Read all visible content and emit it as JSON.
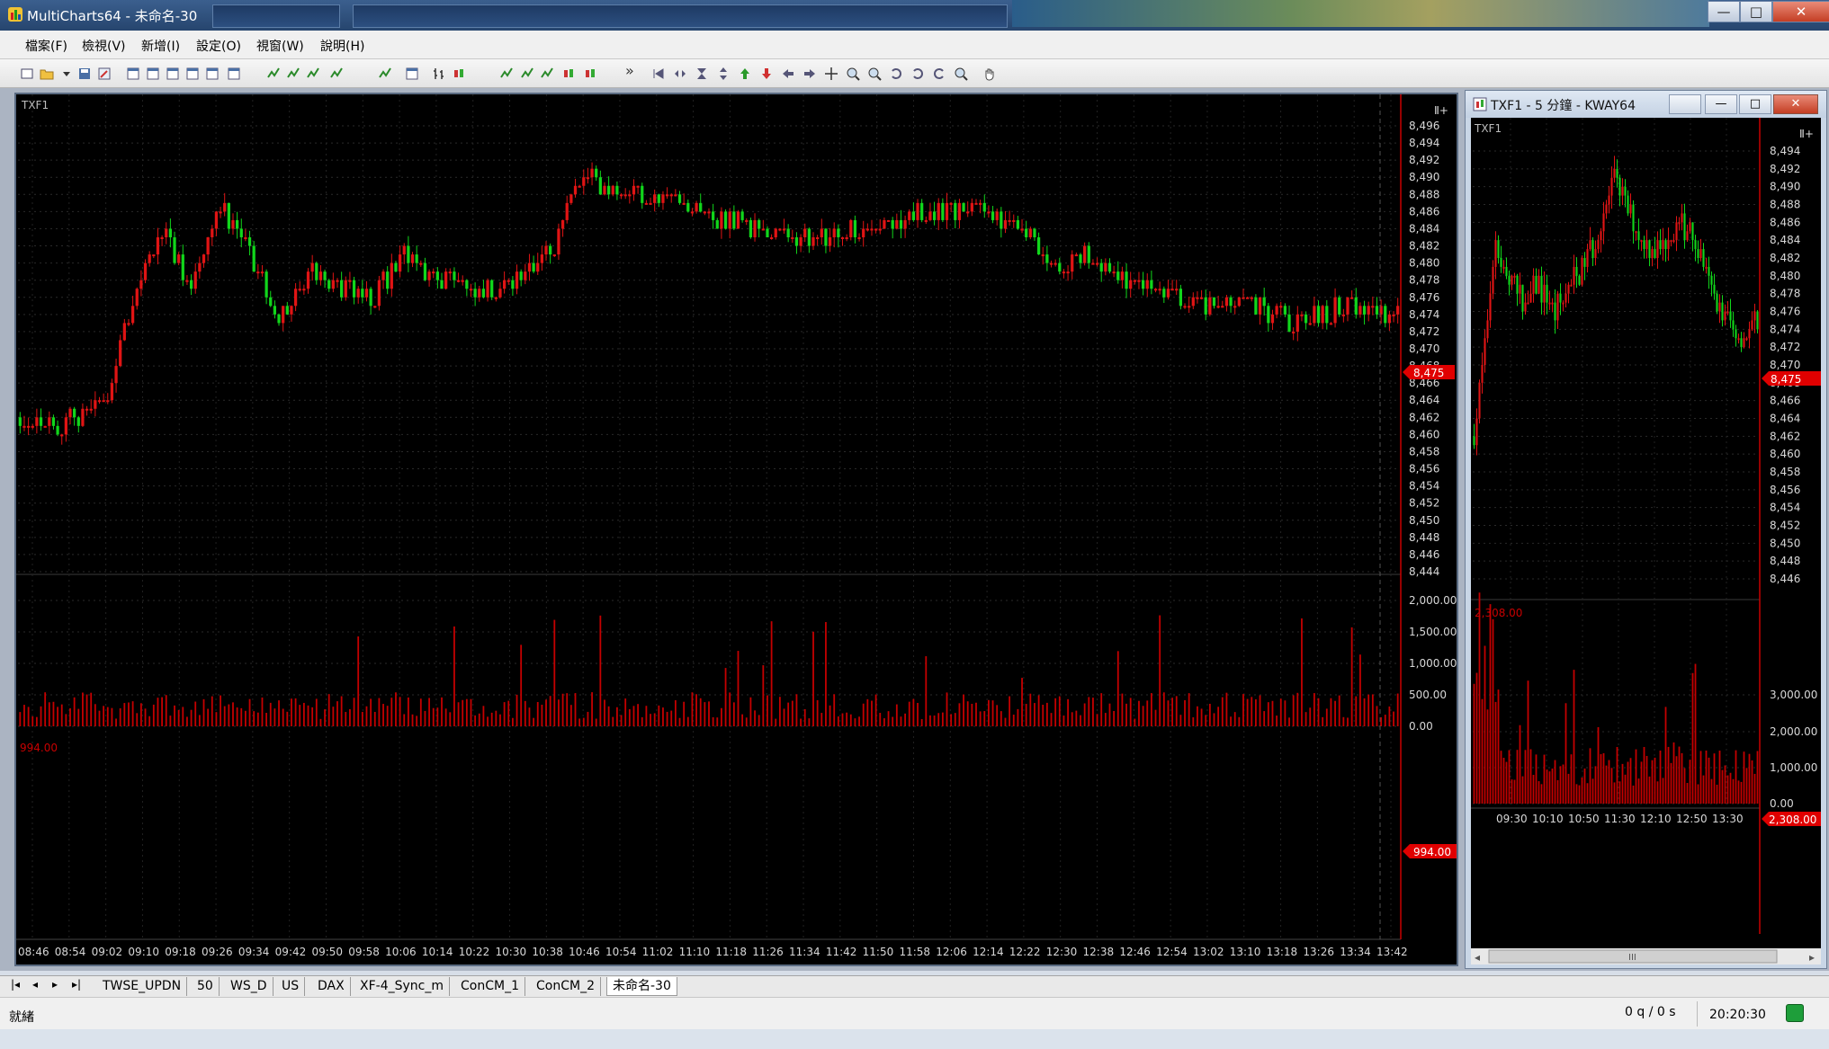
{
  "app": {
    "title": "MultiCharts64 - 未命名-30"
  },
  "window_buttons": {
    "minimize": "—",
    "maximize": "□",
    "close": "✕"
  },
  "menu": [
    "檔案(F)",
    "檢視(V)",
    "新增(I)",
    "設定(O)",
    "視窗(W)",
    "說明(H)"
  ],
  "toolbar": {
    "overflow": "»"
  },
  "chart1": {
    "symbol": "TXF1",
    "marker": "Ⅱ+",
    "price_ticks": [
      "8,496",
      "8,494",
      "8,492",
      "8,490",
      "8,488",
      "8,486",
      "8,484",
      "8,482",
      "8,480",
      "8,478",
      "8,476",
      "8,474",
      "8,472",
      "8,470",
      "8,468",
      "8,466",
      "8,464",
      "8,462",
      "8,460",
      "8,458",
      "8,456",
      "8,454",
      "8,452",
      "8,450",
      "8,448",
      "8,446",
      "8,444"
    ],
    "last_price": "8,475",
    "volume_label": "994.00",
    "volume_ticks": [
      "2,000.00",
      "1,500.00",
      "1,000.00",
      "500.00",
      "0.00"
    ],
    "volume_last": "994.00",
    "time_ticks": [
      "08:46",
      "08:54",
      "09:02",
      "09:10",
      "09:18",
      "09:26",
      "09:34",
      "09:42",
      "09:50",
      "09:58",
      "10:06",
      "10:14",
      "10:22",
      "10:30",
      "10:38",
      "10:46",
      "10:54",
      "11:02",
      "11:10",
      "11:18",
      "11:26",
      "11:34",
      "11:42",
      "11:50",
      "11:58",
      "12:06",
      "12:14",
      "12:22",
      "12:30",
      "12:38",
      "12:46",
      "12:54",
      "13:02",
      "13:10",
      "13:18",
      "13:26",
      "13:34",
      "13:42"
    ]
  },
  "chart2": {
    "window_title": "TXF1 - 5 分鐘 - KWAY64",
    "symbol": "TXF1",
    "marker": "Ⅱ+",
    "price_ticks": [
      "8,494",
      "8,492",
      "8,490",
      "8,488",
      "8,486",
      "8,484",
      "8,482",
      "8,480",
      "8,478",
      "8,476",
      "8,474",
      "8,472",
      "8,470",
      "8,468",
      "8,466",
      "8,464",
      "8,462",
      "8,460",
      "8,458",
      "8,456",
      "8,454",
      "8,452",
      "8,450",
      "8,448",
      "8,446"
    ],
    "last_price": "8,475",
    "volume_label": "2,308.00",
    "volume_ticks": [
      "3,000.00",
      "2,000.00",
      "1,000.00",
      "0.00"
    ],
    "volume_last": "2,308.00",
    "time_ticks": [
      "09:30",
      "10:10",
      "10:50",
      "11:30",
      "12:10",
      "12:50",
      "13:30"
    ],
    "scroll_grip": "III",
    "scroll_left": "◂",
    "scroll_right": "▸"
  },
  "sheet_nav": [
    "|◂",
    "◂",
    "▸",
    "▸|"
  ],
  "sheets": [
    "TWSE_UPDN",
    "50",
    "WS_D",
    "US",
    "DAX",
    "XF-4_Sync_m",
    "ConCM_1",
    "ConCM_2",
    "未命名-30"
  ],
  "active_sheet": "未命名-30",
  "status": {
    "ready": "就緒",
    "quotes": "0 q / 0 s",
    "clock": "20:20:30"
  },
  "colors": {
    "up": "#e01414",
    "down": "#11d61b",
    "price_axis": "#c80000",
    "volume": "#c40000",
    "tag": "#e00000",
    "axis_text": "#d8d8d8"
  }
}
